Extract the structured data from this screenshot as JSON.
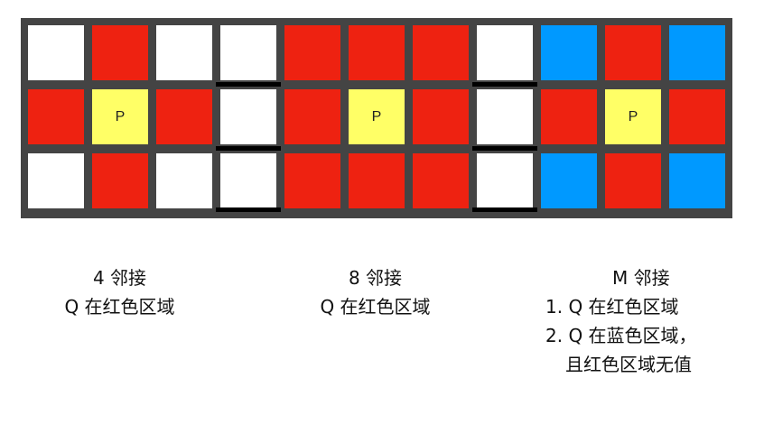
{
  "colors": {
    "white": "#ffffff",
    "red": "#ee2211",
    "yellow": "#ffff66",
    "blue": "#0099ff",
    "border": "#444444",
    "separator": "#000000"
  },
  "grid": {
    "rows": [
      [
        "white",
        "red",
        "white",
        "white",
        "red",
        "red",
        "red",
        "white",
        "blue",
        "red",
        "blue"
      ],
      [
        "red",
        "yellow",
        "red",
        "white",
        "red",
        "yellow",
        "red",
        "white",
        "red",
        "yellow",
        "red"
      ],
      [
        "white",
        "red",
        "white",
        "white",
        "red",
        "red",
        "red",
        "white",
        "blue",
        "red",
        "blue"
      ]
    ],
    "center_label": "P"
  },
  "captions": {
    "four": {
      "title": "4 邻接",
      "lines": [
        "Q 在红色区域"
      ]
    },
    "eight": {
      "title": "8 邻接",
      "lines": [
        "Q 在红色区域"
      ]
    },
    "m": {
      "title": "M 邻接",
      "lines": [
        "1. Q 在红色区域",
        "2. Q 在蓝色区域，",
        "且红色区域无值"
      ]
    }
  }
}
